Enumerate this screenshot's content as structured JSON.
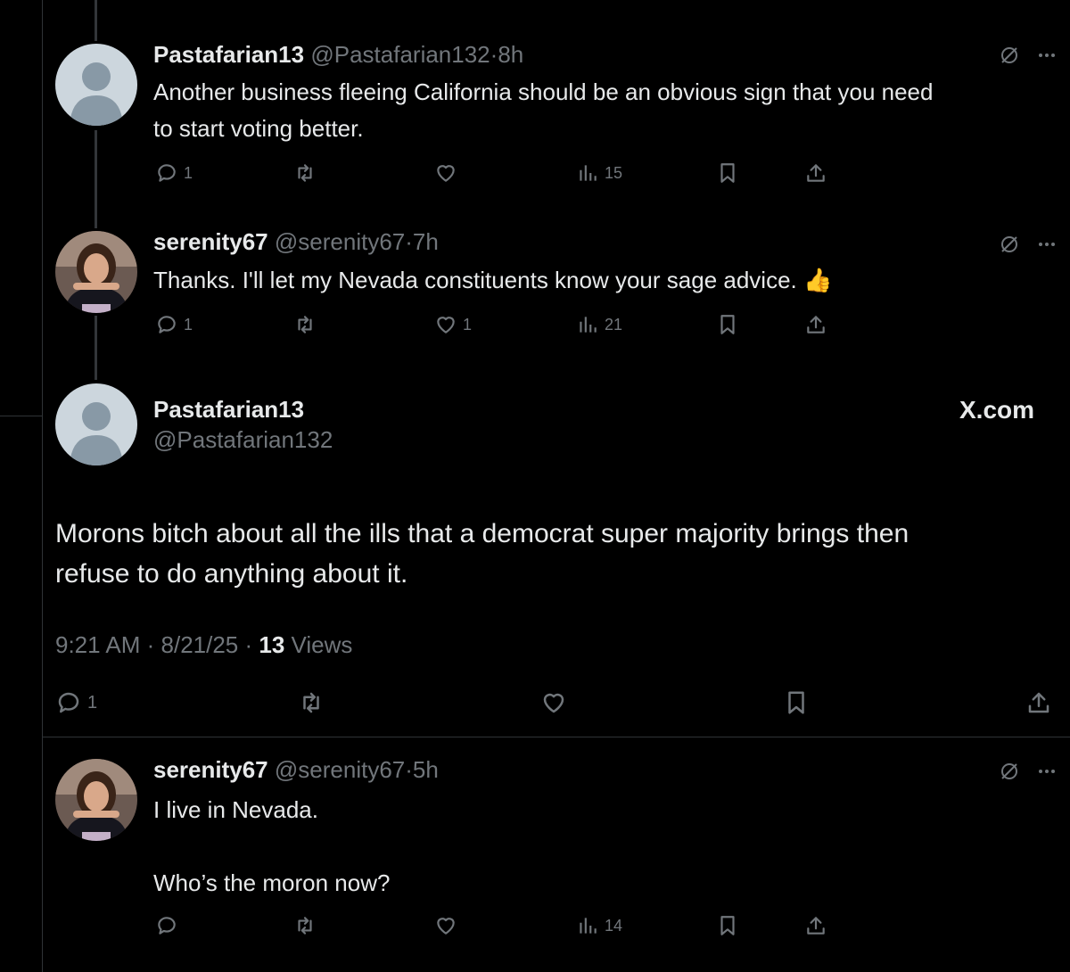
{
  "tweets": [
    {
      "name": "Pastafarian13",
      "handle": "@Pastafarian132",
      "time": "8h",
      "text_lines": [
        "Another business fleeing California should be an obvious sign that you need",
        "to start voting better."
      ],
      "replies": "1",
      "likes": "",
      "views": "15",
      "avatar": "default-avatar"
    },
    {
      "name": "serenity67",
      "handle": "@serenity67",
      "time": "7h",
      "text_lines": [
        "Thanks. I'll let my Nevada constituents know your sage advice. 👍"
      ],
      "replies": "1",
      "likes": "1",
      "views": "21",
      "avatar": "photo-avatar"
    }
  ],
  "main_tweet": {
    "name": "Pastafarian13",
    "handle": "@Pastafarian132",
    "watermark": "X.com",
    "text_lines": [
      "Morons bitch about all the ills that a democrat super majority brings then",
      "refuse to do anything about it."
    ],
    "time": "9:21 AM",
    "date": "8/21/25",
    "views_count": "13",
    "views_label": "Views",
    "replies": "1"
  },
  "reply": {
    "name": "serenity67",
    "handle": "@serenity67",
    "time": "5h",
    "text_lines": [
      "I live in Nevada.",
      "",
      "Who’s the moron now?"
    ],
    "views": "14"
  },
  "colors": {
    "background": "#000000",
    "text": "#e7e9ea",
    "muted": "#71767b",
    "border": "#2f3336"
  },
  "icons": [
    "reply-icon",
    "retweet-icon",
    "like-icon",
    "views-icon",
    "bookmark-icon",
    "share-icon",
    "grok-icon",
    "more-icon"
  ]
}
